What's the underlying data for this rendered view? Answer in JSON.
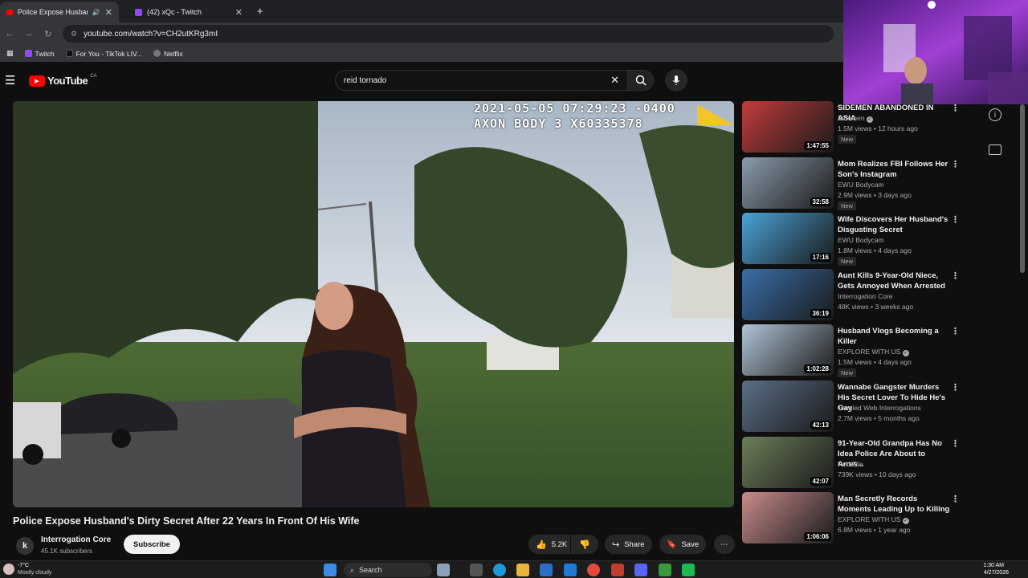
{
  "browser": {
    "tabs": [
      {
        "title": "Police Expose Husband's Di",
        "active": true
      },
      {
        "title": "(42) xQc - Twitch",
        "active": false
      }
    ],
    "new_tab": "+",
    "url": "youtube.com/watch?v=CH2utKRg3mI",
    "bookmarks": [
      "Twitch",
      "For You - TikTok LIV...",
      "Netflix"
    ]
  },
  "youtube": {
    "logo_text": "YouTube",
    "region": "CA",
    "search_value": "reid tornado"
  },
  "player": {
    "timestamp": "2021-05-05 07:29:23 -0400",
    "camera": "AXON BODY 3 X60335378"
  },
  "video": {
    "title": "Police Expose Husband's Dirty Secret After 22 Years In Front Of His Wife",
    "channel": "Interrogation Core",
    "subscribers": "45.1K subscribers",
    "subscribe_label": "Subscribe",
    "likes": "5.2K",
    "share_label": "Share",
    "save_label": "Save"
  },
  "recommendations": [
    {
      "title": "SIDEMEN ABANDONED IN ASIA",
      "channel": "Sidemen",
      "verified": true,
      "meta": "1.5M views • 12 hours ago",
      "new": "New",
      "duration": "1:47:55",
      "thumb": "#c33c3c"
    },
    {
      "title": "Mom Realizes FBI Follows Her Son's Instagram",
      "channel": "EWU Bodycam",
      "verified": false,
      "meta": "2.9M views • 3 days ago",
      "new": "New",
      "duration": "32:58",
      "thumb": "#8a9bab"
    },
    {
      "title": "Wife Discovers Her Husband's Disgusting Secret",
      "channel": "EWU Bodycam",
      "verified": false,
      "meta": "1.8M views • 4 days ago",
      "new": "New",
      "duration": "17:16",
      "thumb": "#4aa3d8"
    },
    {
      "title": "Aunt Kills 9-Year-Old Niece, Gets Annoyed When Arrested",
      "channel": "Interrogation Core",
      "verified": false,
      "meta": "48K views • 3 weeks ago",
      "new": "",
      "duration": "36:19",
      "thumb": "#3a6fa8"
    },
    {
      "title": "Husband Vlogs Becoming a Killer",
      "channel": "EXPLORE WITH US",
      "verified": true,
      "meta": "1.5M views • 4 days ago",
      "new": "New",
      "duration": "1:02:28",
      "thumb": "#b0c4d6"
    },
    {
      "title": "Wannabe Gangster Murders His Secret Lover To Hide He's Gay",
      "channel": "Tangled Web Interrogations",
      "verified": false,
      "meta": "2.7M views • 5 months ago",
      "new": "",
      "duration": "42:13",
      "thumb": "#5b6f86"
    },
    {
      "title": "91-Year-Old Grandpa Has No Idea Police Are About to Arres...",
      "channel": "Red File",
      "verified": false,
      "meta": "739K views • 10 days ago",
      "new": "",
      "duration": "42:07",
      "thumb": "#6c7e5a"
    },
    {
      "title": "Man Secretly Records Moments Leading Up to Killing",
      "channel": "EXPLORE WITH US",
      "verified": true,
      "meta": "6.8M views • 1 year ago",
      "new": "",
      "duration": "1:06:06",
      "thumb": "#c98b8b"
    }
  ],
  "taskbar": {
    "weather_temp": "-7°C",
    "weather_desc": "Mostly cloudy",
    "search_label": "Search",
    "time": "1:30 AM",
    "date": "4/27/2026"
  }
}
